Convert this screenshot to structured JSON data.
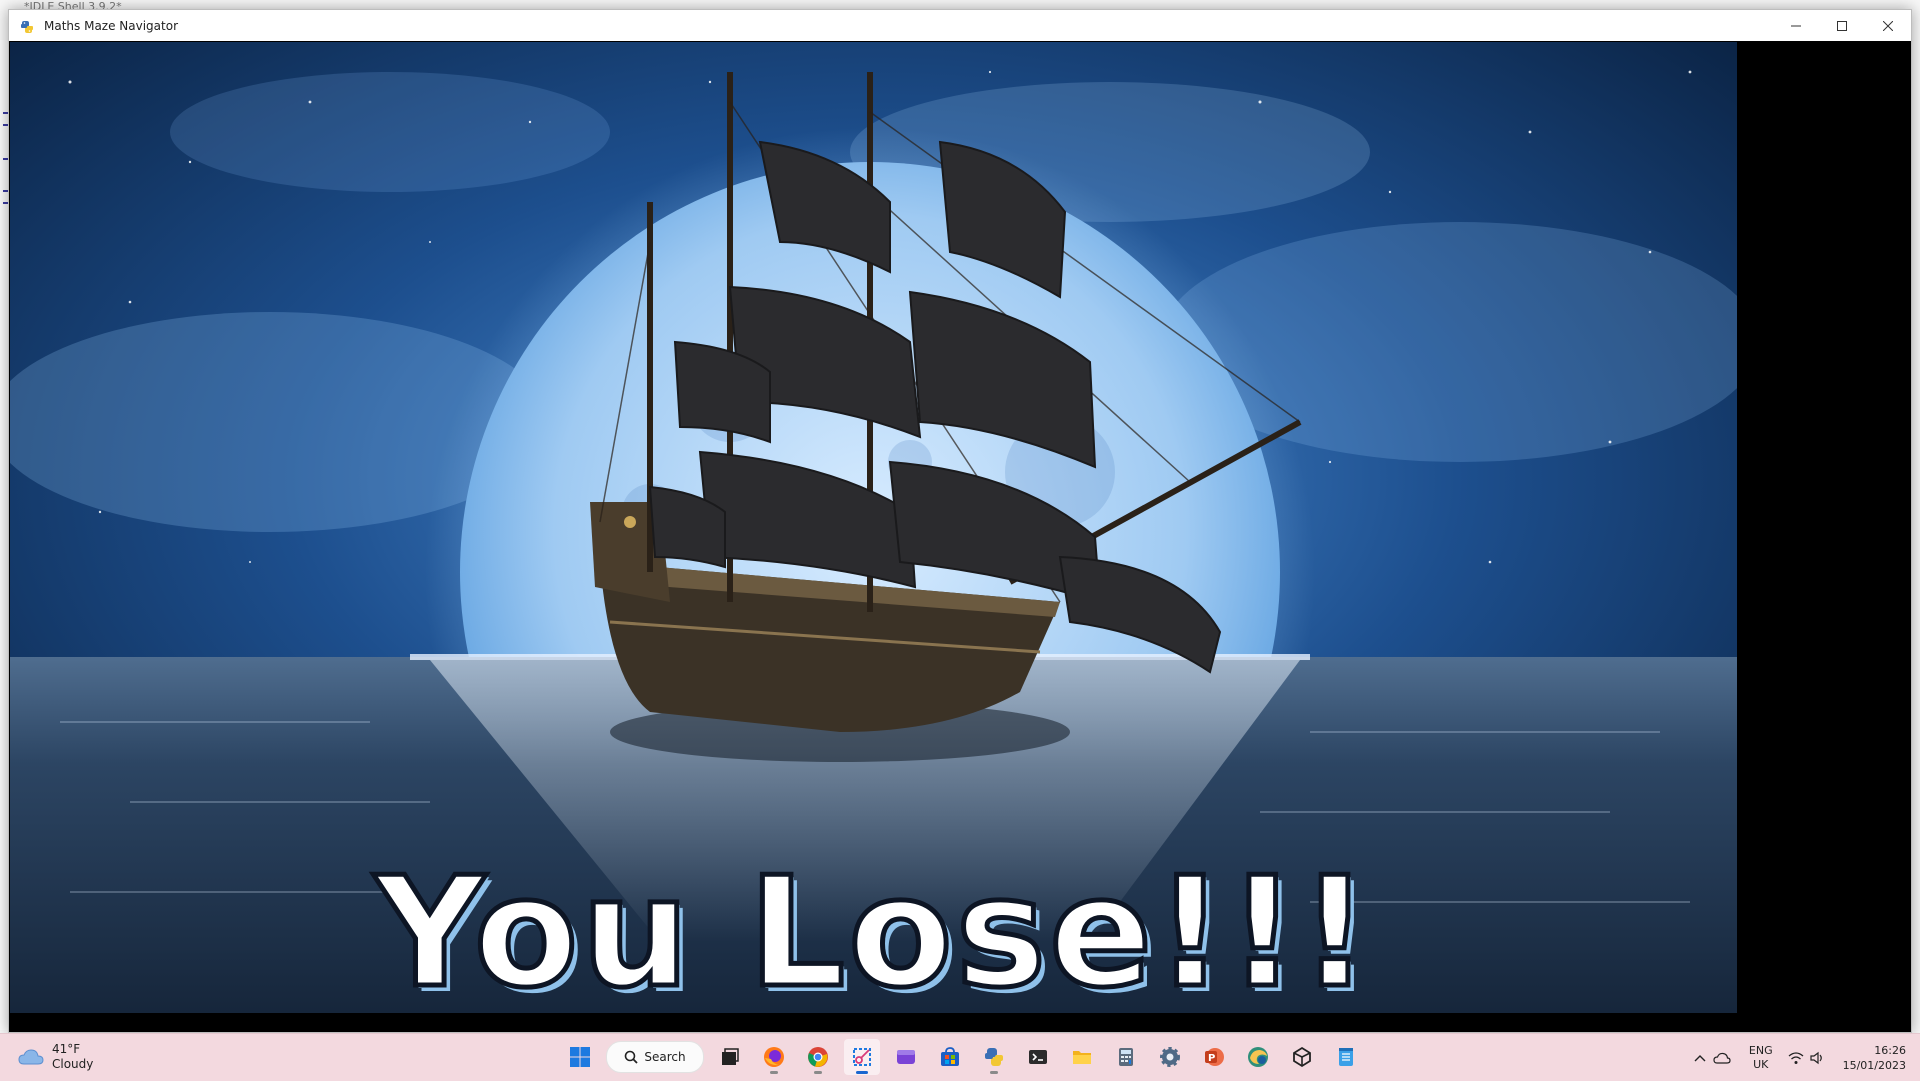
{
  "background_window": {
    "title": "*IDLE Shell 3.9.2*"
  },
  "window": {
    "title": "Maths Maze Navigator",
    "controls": {
      "minimize": "minimize",
      "maximize": "maximize",
      "close": "close"
    }
  },
  "game": {
    "message": "You Lose!!!",
    "scene": "pirate-ship-moon-background"
  },
  "taskbar": {
    "weather": {
      "temperature": "41°F",
      "condition": "Cloudy"
    },
    "search_label": "Search",
    "pinned_apps": [
      "start-icon",
      "search",
      "task-view-icon",
      "firefox-icon",
      "chrome-icon",
      "snipping-tool-icon",
      "clipchamp-icon",
      "microsoft-store-icon",
      "python-icon",
      "terminal-icon",
      "file-explorer-icon",
      "calculator-icon",
      "settings-icon",
      "powerpoint-icon",
      "edge-canary-icon",
      "unity-icon",
      "notepad-icon"
    ],
    "tray": {
      "language": "ENG",
      "region": "UK",
      "time": "16:26",
      "date": "15/01/2023"
    }
  },
  "colors": {
    "taskbar": "#f3d9df",
    "text_fill": "#ffffff",
    "text_outline": "#0d1524",
    "text_shadow": "#8fc1ea",
    "accent": "#1a66d0"
  }
}
